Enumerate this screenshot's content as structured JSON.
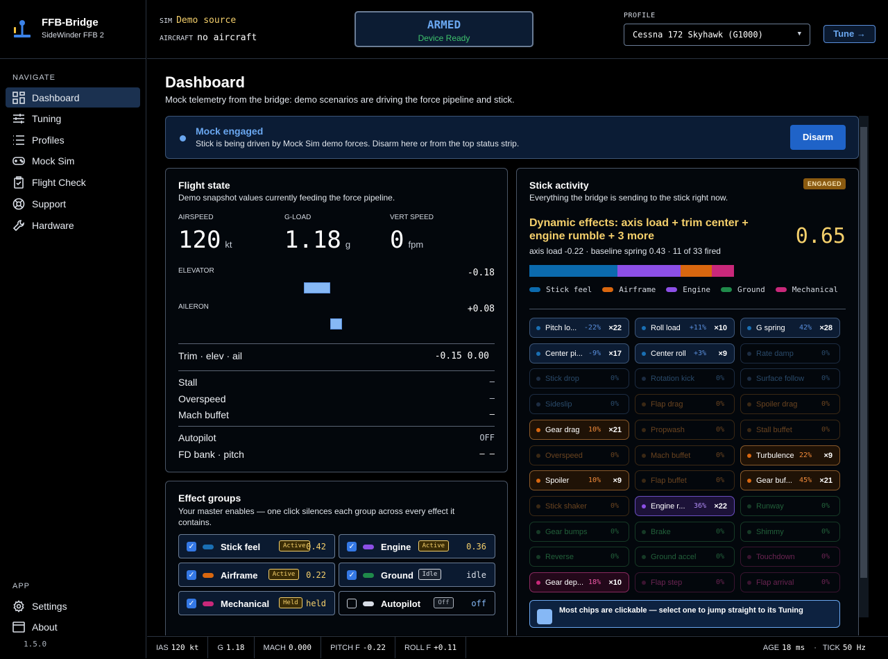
{
  "app": {
    "name": "FFB-Bridge",
    "device": "SideWinder FFB 2",
    "version": "1.5.0"
  },
  "nav": {
    "heading": "NAVIGATE",
    "items": [
      {
        "label": "Dashboard",
        "icon": "grid-icon"
      },
      {
        "label": "Tuning",
        "icon": "sliders-icon"
      },
      {
        "label": "Profiles",
        "icon": "list-icon"
      },
      {
        "label": "Mock Sim",
        "icon": "gamepad-icon"
      },
      {
        "label": "Flight Check",
        "icon": "clipboard-icon"
      },
      {
        "label": "Support",
        "icon": "lifebuoy-icon"
      },
      {
        "label": "Hardware",
        "icon": "wrench-icon"
      }
    ],
    "app_heading": "APP",
    "app_items": [
      {
        "label": "Settings",
        "icon": "gear-icon"
      },
      {
        "label": "About",
        "icon": "window-icon"
      }
    ]
  },
  "topbar": {
    "sim_key": "SIM",
    "sim_value": "Demo source",
    "aircraft_key": "AIRCRAFT",
    "aircraft_value": "no aircraft",
    "armed_title": "ARMED",
    "armed_sub": "Device Ready",
    "profile_label": "PROFILE",
    "profile_value": "Cessna 172 Skyhawk (G1000)",
    "tune_label": "Tune →"
  },
  "page": {
    "title": "Dashboard",
    "subtitle": "Mock telemetry from the bridge: demo scenarios are driving the force pipeline and stick."
  },
  "mock": {
    "title": "Mock engaged",
    "text": "Stick is being driven by Mock Sim demo forces. Disarm here or from the top status strip.",
    "button": "Disarm"
  },
  "flight": {
    "title": "Flight state",
    "subtitle": "Demo snapshot values currently feeding the force pipeline.",
    "stats": [
      {
        "label": "AIRSPEED",
        "value": "120",
        "unit": "kt"
      },
      {
        "label": "G-LOAD",
        "value": "1.18",
        "unit": "g"
      },
      {
        "label": "VERT SPEED",
        "value": "0",
        "unit": "fpm"
      }
    ],
    "elevator_label": "ELEVATOR",
    "elevator_value": "-0.18",
    "aileron_label": "AILERON",
    "aileron_value": "+0.08",
    "trim_label": "Trim · elev · ail",
    "trim_value": "-0.15 0.00",
    "rows": [
      {
        "label": "Stall",
        "value": "–"
      },
      {
        "label": "Overspeed",
        "value": "–"
      },
      {
        "label": "Mach buffet",
        "value": "—"
      },
      {
        "label": "Autopilot",
        "value": "OFF"
      },
      {
        "label": "FD bank · pitch",
        "value": "– –"
      }
    ]
  },
  "groups": {
    "title": "Effect groups",
    "subtitle": "Your master enables — one click silences each group across every effect it contains.",
    "items": [
      {
        "name": "Stick feel",
        "tag": "Active",
        "value": "0.42",
        "color": "#1a6fb3",
        "checked": true
      },
      {
        "name": "Engine",
        "tag": "Active",
        "value": "0.36",
        "color": "#8c4fe6",
        "checked": true
      },
      {
        "name": "Airframe",
        "tag": "Active",
        "value": "0.22",
        "color": "#d9670f",
        "checked": true
      },
      {
        "name": "Ground",
        "tag": "Idle",
        "value": "idle",
        "color": "#1f8a4a",
        "checked": true
      },
      {
        "name": "Mechanical",
        "tag": "Held",
        "value": "held",
        "color": "#c9287a",
        "checked": true
      },
      {
        "name": "Autopilot",
        "tag": "Off",
        "value": "off",
        "color": "#d8dde6",
        "checked": false
      }
    ]
  },
  "stick": {
    "title": "Stick activity",
    "subtitle": "Everything the bridge is sending to the stick right now.",
    "badge": "ENGAGED",
    "dyn_title": "Dynamic effects: axis load + trim center + engine rumble + 3 more",
    "dyn_value": "0.65",
    "dyn_sub": "axis load -0.22 · baseline spring 0.43 · 11 of 33 fired",
    "legend": [
      {
        "name": "Stick feel",
        "color": "#0b6aad",
        "share": 0.43
      },
      {
        "name": "Airframe",
        "color": "#d9670f",
        "share": 0.15
      },
      {
        "name": "Engine",
        "color": "#8c4fe6",
        "share": 0.31
      },
      {
        "name": "Ground",
        "color": "#1f8a4a",
        "share": 0
      },
      {
        "name": "Mechanical",
        "color": "#c9287a",
        "share": 0.11
      }
    ],
    "chips": [
      {
        "label": "Pitch lo...",
        "pct": "-22%",
        "count": "×22",
        "group": "stick",
        "active": true
      },
      {
        "label": "Roll load",
        "pct": "+11%",
        "count": "×10",
        "group": "stick",
        "active": true
      },
      {
        "label": "G spring",
        "pct": "42%",
        "count": "×28",
        "group": "stick",
        "active": true
      },
      {
        "label": "Center pi...",
        "pct": "-9%",
        "count": "×17",
        "group": "stick",
        "active": true
      },
      {
        "label": "Center roll",
        "pct": "+3%",
        "count": "×9",
        "group": "stick",
        "active": true
      },
      {
        "label": "Rate damp",
        "pct": "0%",
        "count": "",
        "group": "stick",
        "active": false
      },
      {
        "label": "Stick drop",
        "pct": "0%",
        "count": "",
        "group": "stick",
        "active": false
      },
      {
        "label": "Rotation kick",
        "pct": "0%",
        "count": "",
        "group": "stick",
        "active": false
      },
      {
        "label": "Surface follow",
        "pct": "0%",
        "count": "",
        "group": "stick",
        "active": false
      },
      {
        "label": "Sideslip",
        "pct": "0%",
        "count": "",
        "group": "stick",
        "active": false
      },
      {
        "label": "Flap drag",
        "pct": "0%",
        "count": "",
        "group": "air",
        "active": false
      },
      {
        "label": "Spoiler drag",
        "pct": "0%",
        "count": "",
        "group": "air",
        "active": false
      },
      {
        "label": "Gear drag",
        "pct": "10%",
        "count": "×21",
        "group": "air",
        "active": true
      },
      {
        "label": "Propwash",
        "pct": "0%",
        "count": "",
        "group": "air",
        "active": false
      },
      {
        "label": "Stall buffet",
        "pct": "0%",
        "count": "",
        "group": "air",
        "active": false
      },
      {
        "label": "Overspeed",
        "pct": "0%",
        "count": "",
        "group": "air",
        "active": false
      },
      {
        "label": "Mach buffet",
        "pct": "0%",
        "count": "",
        "group": "air",
        "active": false
      },
      {
        "label": "Turbulence",
        "pct": "22%",
        "count": "×9",
        "group": "air",
        "active": true
      },
      {
        "label": "Spoiler",
        "pct": "10%",
        "count": "×9",
        "group": "air",
        "active": true
      },
      {
        "label": "Flap buffet",
        "pct": "0%",
        "count": "",
        "group": "air",
        "active": false
      },
      {
        "label": "Gear buf...",
        "pct": "45%",
        "count": "×21",
        "group": "air",
        "active": true
      },
      {
        "label": "Stick shaker",
        "pct": "0%",
        "count": "",
        "group": "air",
        "active": false
      },
      {
        "label": "Engine r...",
        "pct": "36%",
        "count": "×22",
        "group": "eng",
        "active": true
      },
      {
        "label": "Runway",
        "pct": "0%",
        "count": "",
        "group": "ground",
        "active": false
      },
      {
        "label": "Gear bumps",
        "pct": "0%",
        "count": "",
        "group": "ground",
        "active": false
      },
      {
        "label": "Brake",
        "pct": "0%",
        "count": "",
        "group": "ground",
        "active": false
      },
      {
        "label": "Shimmy",
        "pct": "0%",
        "count": "",
        "group": "ground",
        "active": false
      },
      {
        "label": "Reverse",
        "pct": "0%",
        "count": "",
        "group": "ground",
        "active": false
      },
      {
        "label": "Ground accel",
        "pct": "0%",
        "count": "",
        "group": "ground",
        "active": false
      },
      {
        "label": "Touchdown",
        "pct": "0%",
        "count": "",
        "group": "mech",
        "active": false
      },
      {
        "label": "Gear dep...",
        "pct": "18%",
        "count": "×10",
        "group": "mech",
        "active": true
      },
      {
        "label": "Flap step",
        "pct": "0%",
        "count": "",
        "group": "mech",
        "active": false
      },
      {
        "label": "Flap arrival",
        "pct": "0%",
        "count": "",
        "group": "mech",
        "active": false
      }
    ],
    "hint": "Most chips are clickable — select one to jump straight to its Tuning"
  },
  "status": {
    "items": [
      {
        "k": "IAS",
        "v": "120 kt"
      },
      {
        "k": "G",
        "v": "1.18"
      },
      {
        "k": "MACH",
        "v": "0.000"
      },
      {
        "k": "PITCH F",
        "v": "-0.22"
      },
      {
        "k": "ROLL F",
        "v": "+0.11"
      }
    ],
    "age_k": "AGE",
    "age_v": "18 ms",
    "sep": "·",
    "tick_k": "TICK",
    "tick_v": "50 Hz"
  },
  "colors": {
    "accent": "#6aa7f0",
    "stick": "#0b6aad",
    "air": "#d9670f",
    "eng": "#8c4fe6",
    "ground": "#1f8a4a",
    "mech": "#c9287a"
  },
  "bars": {
    "elevator": -0.18,
    "aileron": 0.08
  }
}
